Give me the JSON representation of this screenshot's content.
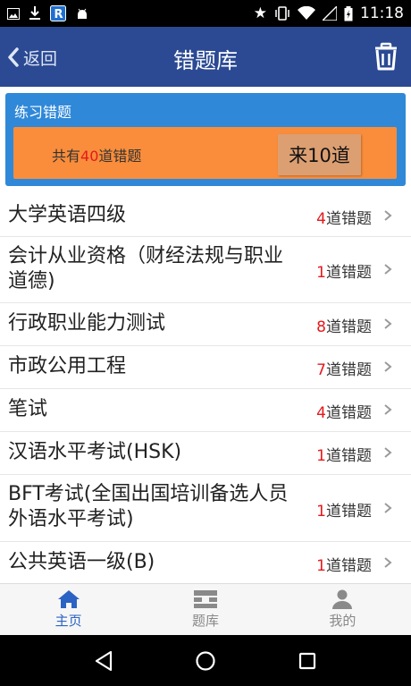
{
  "status_bar": {
    "time": "11:18",
    "left_icons": [
      "image-icon",
      "download-icon",
      "r-app-icon",
      "android-icon"
    ],
    "right_icons": [
      "star-icon",
      "vibrate-icon",
      "wifi-icon",
      "signal-icon",
      "battery-icon"
    ]
  },
  "nav": {
    "back_label": "返回",
    "title": "错题库"
  },
  "practice": {
    "title": "练习错题",
    "summary_prefix": "共有",
    "summary_count": "40",
    "summary_suffix": "道错题",
    "button_label": "来10道"
  },
  "items": [
    {
      "name": "大学英语四级",
      "count": "4",
      "suffix": "道错题"
    },
    {
      "name": "会计从业资格（财经法规与职业道德)",
      "count": "1",
      "suffix": "道错题"
    },
    {
      "name": "行政职业能力测试",
      "count": "8",
      "suffix": "道错题"
    },
    {
      "name": "市政公用工程",
      "count": "7",
      "suffix": "道错题"
    },
    {
      "name": "笔试",
      "count": "4",
      "suffix": "道错题"
    },
    {
      "name": "汉语水平考试(HSK)",
      "count": "1",
      "suffix": "道错题"
    },
    {
      "name": "BFT考试(全国出国培训备选人员外语水平考试)",
      "count": "1",
      "suffix": "道错题"
    },
    {
      "name": "公共英语一级(B)",
      "count": "1",
      "suffix": "道错题"
    }
  ],
  "tabs": [
    {
      "label": "主页",
      "icon": "home-icon",
      "active": true
    },
    {
      "label": "题库",
      "icon": "question-bank-icon",
      "active": false
    },
    {
      "label": "我的",
      "icon": "person-icon",
      "active": false
    }
  ],
  "colors": {
    "nav_bg": "#2b4a93",
    "card_bg": "#2f88d8",
    "orange": "#f98d3b",
    "accent_red": "#e5191b",
    "tab_active": "#2b63c4"
  }
}
